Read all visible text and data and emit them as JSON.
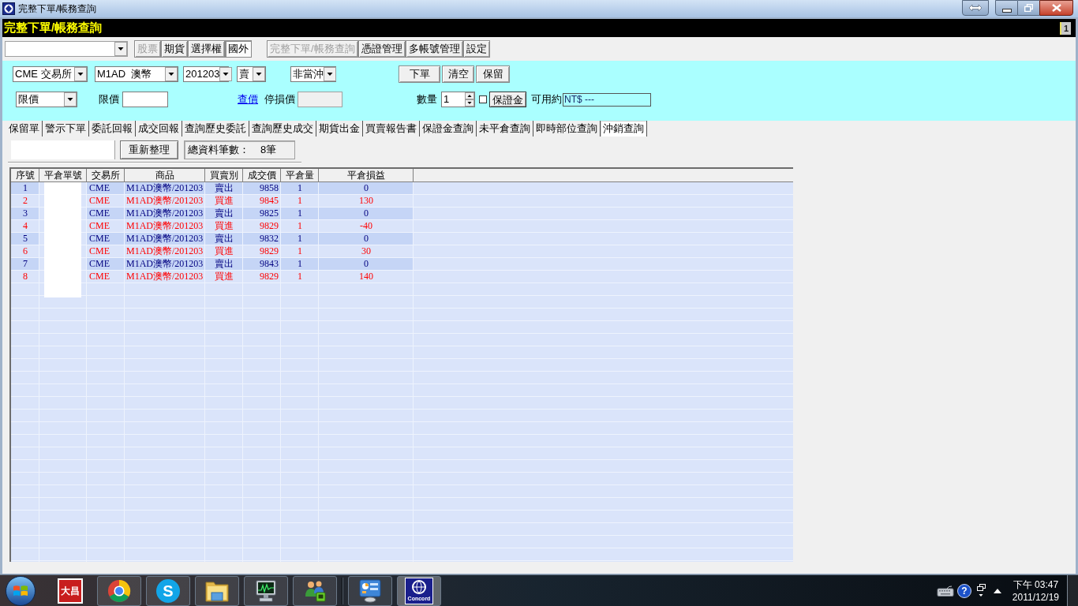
{
  "window": {
    "title": "完整下單/帳務查詢"
  },
  "header": {
    "title": "完整下單/帳務查詢",
    "badge": "1"
  },
  "toolbar": {
    "markets": [
      {
        "label": "股票",
        "selected": false,
        "disabled": true
      },
      {
        "label": "期貨",
        "selected": false,
        "disabled": false
      },
      {
        "label": "選擇權",
        "selected": false,
        "disabled": false
      },
      {
        "label": "國外",
        "selected": true,
        "disabled": false
      }
    ],
    "functions": [
      {
        "label": "完整下單/帳務查詢",
        "disabled": true
      },
      {
        "label": "憑證管理",
        "disabled": false
      },
      {
        "label": "多帳號管理",
        "disabled": false
      },
      {
        "label": "設定",
        "disabled": false
      }
    ]
  },
  "order_form": {
    "exchange": "CME 交易所",
    "product": "M1AD  澳幣",
    "month": "201203",
    "side": "賣",
    "day_trade": "非當沖",
    "actions": [
      "下單",
      "清空",
      "保留"
    ],
    "price_type": "限價",
    "limit_price_label": "限價",
    "quote_link": "查價",
    "stop_price_label": "停損價",
    "quantity_label": "數量",
    "quantity": "1",
    "option_checked": false,
    "margin_button": "保證金",
    "available_label": "可用約",
    "available": "NT$ ---"
  },
  "tabs": [
    {
      "label": "保留單",
      "selected": false
    },
    {
      "label": "警示下單",
      "selected": false
    },
    {
      "label": "委託回報",
      "selected": false
    },
    {
      "label": "成交回報",
      "selected": false
    },
    {
      "label": "查詢歷史委託",
      "selected": false
    },
    {
      "label": "查詢歷史成交",
      "selected": false
    },
    {
      "label": "期貨出金",
      "selected": false
    },
    {
      "label": "買賣報告書",
      "selected": false
    },
    {
      "label": "保證金查詢",
      "selected": false
    },
    {
      "label": "未平倉查詢",
      "selected": false
    },
    {
      "label": "即時部位查詢",
      "selected": false
    },
    {
      "label": "沖銷查詢",
      "selected": true
    }
  ],
  "query": {
    "refresh_button": "重新整理",
    "total_label": "總資料筆數：",
    "total_count": "8筆"
  },
  "table": {
    "columns": [
      "序號",
      "平倉單號",
      "交易所",
      "商品",
      "買賣別",
      "成交價",
      "平倉量",
      "平倉損益"
    ],
    "rows": [
      {
        "kind": "sell",
        "no": "1",
        "exchange": "CME",
        "product": "M1AD澳幣/201203",
        "side": "賣出",
        "price": "9858",
        "quantity": "1",
        "pnl": "0"
      },
      {
        "kind": "buy",
        "no": "2",
        "exchange": "CME",
        "product": "M1AD澳幣/201203",
        "side": "買進",
        "price": "9845",
        "quantity": "1",
        "pnl": "130"
      },
      {
        "kind": "sell",
        "no": "3",
        "exchange": "CME",
        "product": "M1AD澳幣/201203",
        "side": "賣出",
        "price": "9825",
        "quantity": "1",
        "pnl": "0"
      },
      {
        "kind": "buy",
        "no": "4",
        "exchange": "CME",
        "product": "M1AD澳幣/201203",
        "side": "買進",
        "price": "9829",
        "quantity": "1",
        "pnl": "-40"
      },
      {
        "kind": "sell",
        "no": "5",
        "exchange": "CME",
        "product": "M1AD澳幣/201203",
        "side": "賣出",
        "price": "9832",
        "quantity": "1",
        "pnl": "0"
      },
      {
        "kind": "buy",
        "no": "6",
        "exchange": "CME",
        "product": "M1AD澳幣/201203",
        "side": "買進",
        "price": "9829",
        "quantity": "1",
        "pnl": "30"
      },
      {
        "kind": "sell",
        "no": "7",
        "exchange": "CME",
        "product": "M1AD澳幣/201203",
        "side": "賣出",
        "price": "9843",
        "quantity": "1",
        "pnl": "0"
      },
      {
        "kind": "buy",
        "no": "8",
        "exchange": "CME",
        "product": "M1AD澳幣/201203",
        "side": "買進",
        "price": "9829",
        "quantity": "1",
        "pnl": "140"
      }
    ]
  },
  "taskbar": {
    "buttons": [
      {
        "kind": "logo",
        "label": "大昌",
        "running": false,
        "selected": false
      },
      {
        "kind": "circle",
        "running": true,
        "selected": false
      },
      {
        "kind": "letter",
        "label": "S",
        "running": true,
        "selected": false
      },
      {
        "kind": "folder",
        "running": true,
        "selected": false
      },
      {
        "kind": "monitor",
        "running": true,
        "selected": false
      },
      {
        "kind": "people",
        "running": true,
        "selected": false
      },
      {
        "kind": "dashboard",
        "running": true,
        "selected": false
      },
      {
        "kind": "globe",
        "label": "Concord",
        "running": true,
        "selected": true
      }
    ],
    "help": "?",
    "clock": {
      "time": "下午 03:47",
      "date": "2011/12/19"
    }
  }
}
